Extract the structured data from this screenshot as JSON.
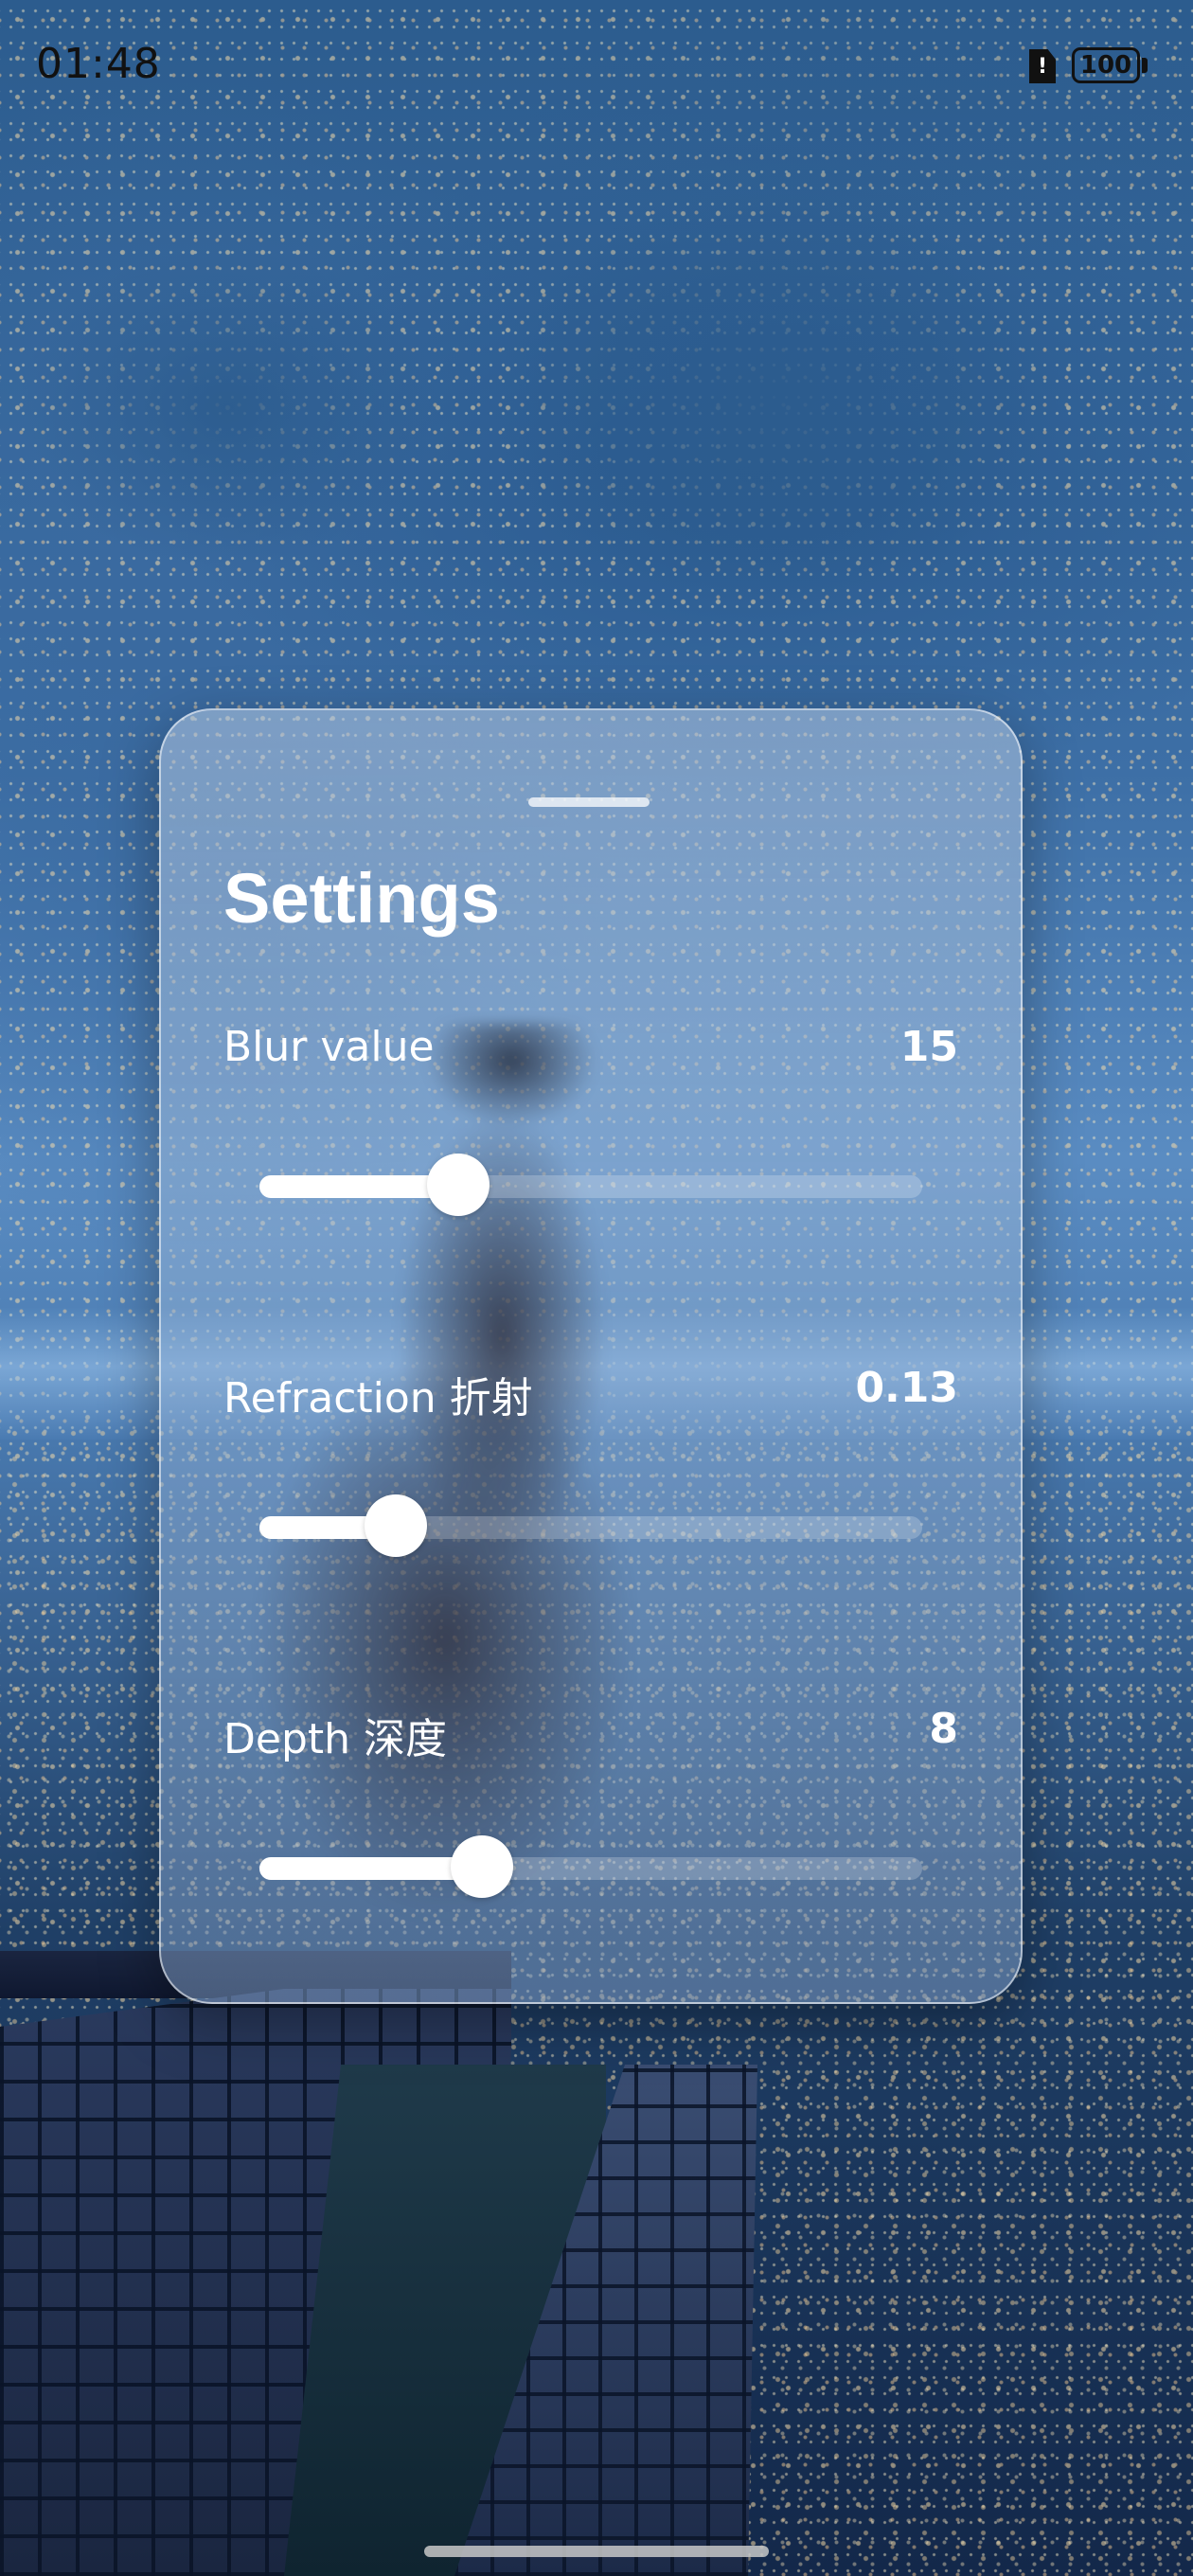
{
  "status_bar": {
    "time": "01:48",
    "sim_icon": "sim-alert-icon",
    "sim_glyph": "!",
    "battery_level": "100"
  },
  "panel": {
    "title": "Settings",
    "settings": [
      {
        "label": "Blur value",
        "value": "15",
        "level": 0.3
      },
      {
        "label": "Refraction 折射",
        "value": "0.13",
        "level": 0.205
      },
      {
        "label": "Depth 深度",
        "value": "8",
        "level": 0.335
      }
    ]
  },
  "colors": {
    "text": "#ffffff",
    "slider_fill": "#ffffff",
    "status_text": "#111111"
  }
}
